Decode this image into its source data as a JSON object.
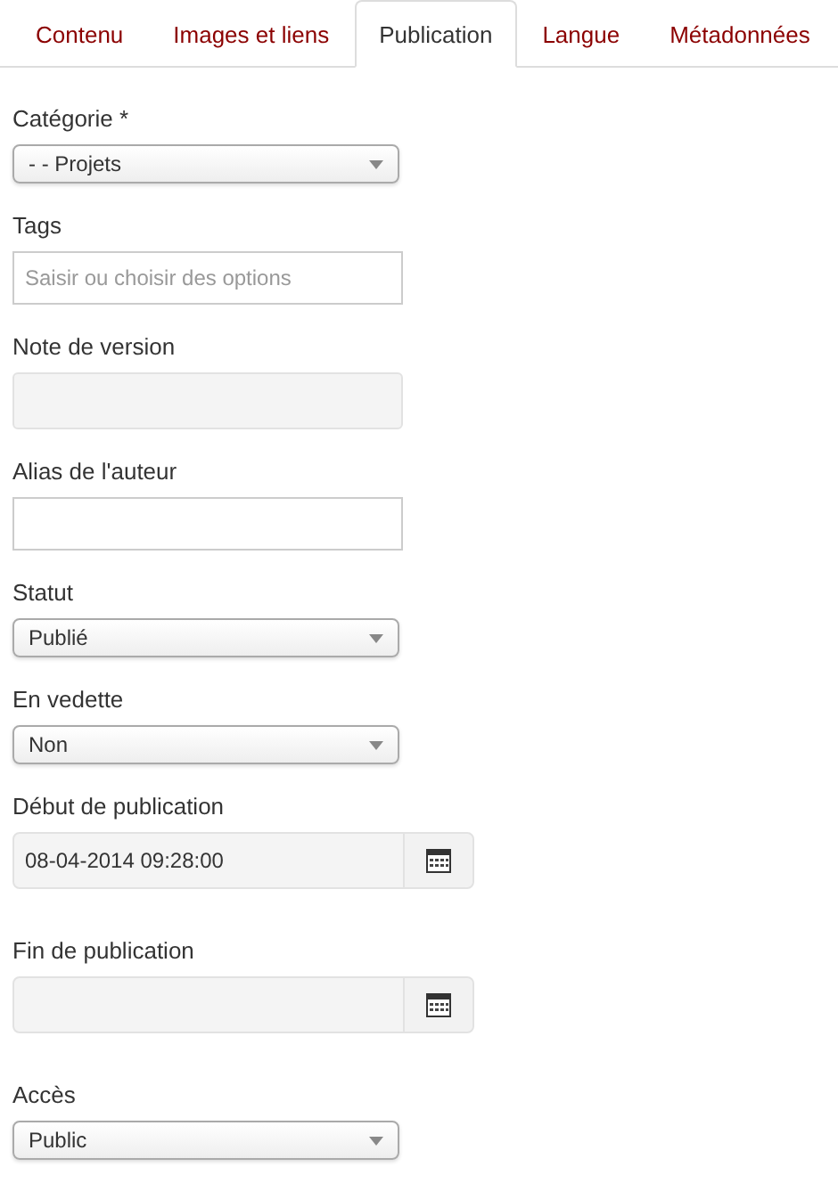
{
  "tabs": [
    {
      "label": "Contenu",
      "selected": false
    },
    {
      "label": "Images et liens",
      "selected": false
    },
    {
      "label": "Publication",
      "selected": true
    },
    {
      "label": "Langue",
      "selected": false
    },
    {
      "label": "Métadonnées",
      "selected": false
    }
  ],
  "fields": [
    {
      "kind": "select",
      "label": "Catégorie *",
      "value": "- - Projets"
    },
    {
      "kind": "text",
      "label": "Tags",
      "placeholder": "Saisir ou choisir des options"
    },
    {
      "kind": "text",
      "label": "Note de version",
      "disabled": true
    },
    {
      "kind": "text",
      "label": "Alias de l'auteur",
      "disabled": false
    },
    {
      "kind": "select",
      "label": "Statut",
      "value": "Publié"
    },
    {
      "kind": "select",
      "label": "En vedette",
      "value": "Non"
    },
    {
      "kind": "date",
      "label": "Début de publication",
      "value": "08-04-2014 09:28:00"
    },
    {
      "kind": "date",
      "label": "Fin de publication"
    },
    {
      "kind": "select",
      "label": "Accès",
      "value": "Public"
    }
  ]
}
